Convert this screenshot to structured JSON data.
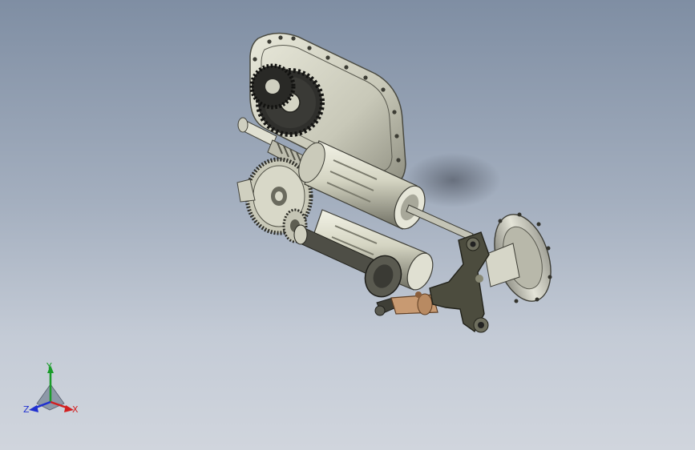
{
  "viewport": {
    "background_top": "#7f8ea3",
    "background_bottom": "#d0d5dd"
  },
  "model": {
    "part_color": "#d6d6c4",
    "metal_color": "#c9c9bb",
    "dark_gear_color": "#2a2a28",
    "bracket_color": "#4a4a3c",
    "brass_color": "#c89a72",
    "housing_flange_icon": "housing-flange-icon",
    "gear_icon": "gear-icon"
  },
  "triad": {
    "x_label": "X",
    "y_label": "Y",
    "z_label": "Z",
    "x_color": "#d22020",
    "y_color": "#1a9c2a",
    "z_color": "#2030d0"
  }
}
